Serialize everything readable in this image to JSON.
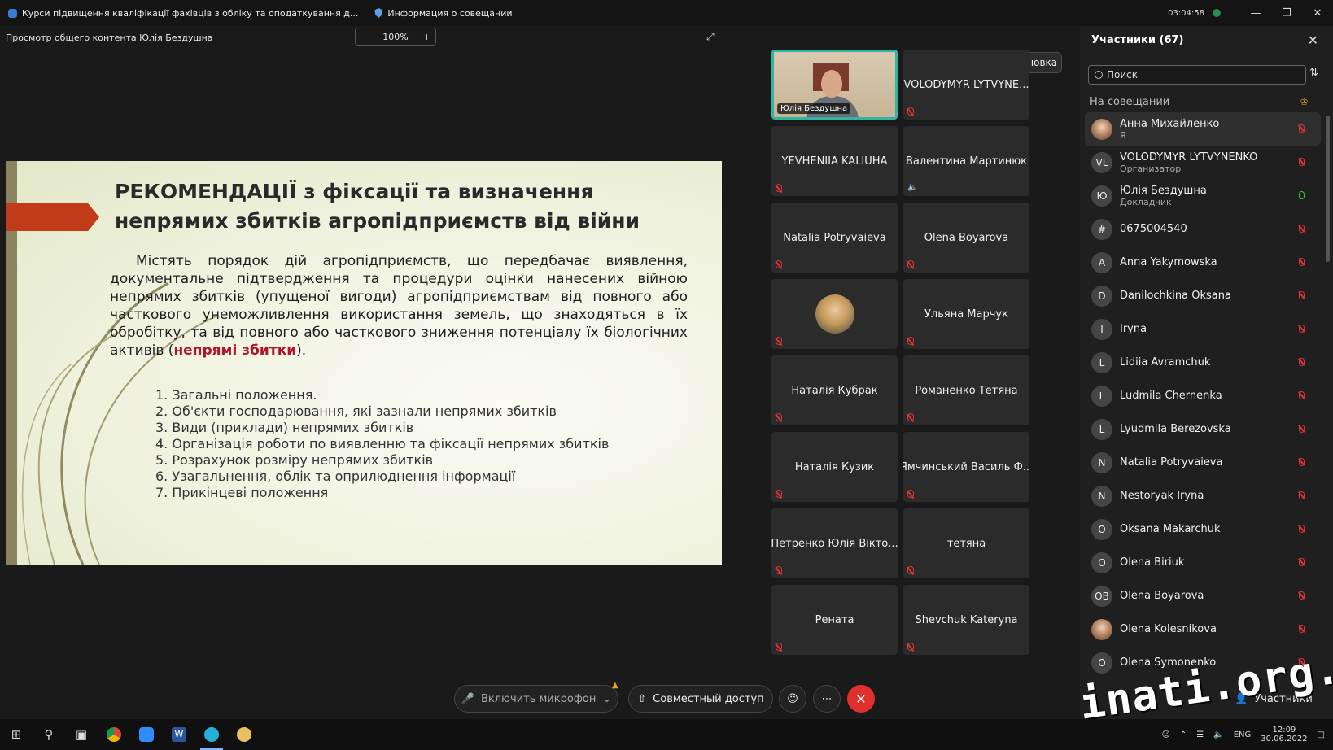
{
  "titlebar": {
    "tab1": "Курси підвищення кваліфікації фахівців з обліку та оподаткування д...",
    "tab2": "Информация о совещании",
    "time": "03:04:58"
  },
  "infobar": {
    "label": "Просмотр общего контента Юлія Бездушна",
    "zoom": "100%"
  },
  "slide": {
    "title": "РЕКОМЕНДАЦІЇ з фіксації та визначення непрямих збитків агропідприємств від війни",
    "para_main": "Містять порядок дій агропідприємств, що передбачає виявлення, документальне підтвердження та процедури оцінки нанесених війною непрямих збитків (упущеної вигоди) агропідприємствам від повного або часткового унеможливлення використання земель, що знаходяться в їх обробітку, та від повного або часткового зниження потенціалу їх біологічних активів (",
    "para_red": "непрямі збитки",
    "para_end": ").",
    "items": [
      "1. Загальні положення.",
      "2. Об'єкти господарювання, які зазнали непрямих збитків",
      "3. Види (приклади) непрямих збитків",
      "4. Організація роботи по виявленню та фіксації непрямих збитків",
      "5. Розрахунок розміру непрямих збитків",
      "6. Узагальнення, облік та оприлюднення інформації",
      "7. Прикінцеві положення"
    ]
  },
  "tiles": {
    "layout_label": "Компоновка",
    "speaker_chip": "Юлія Бездушна",
    "names": [
      "VOLODYMYR LYTVYNE...",
      "YEVHENIIA KALIUHA",
      "Валентина Мартинюк",
      "Natalia Potryvaieva",
      "Olena Boyarova",
      "Ульяна Марчук",
      "Наталія Кубрак",
      "Романенко Тетяна",
      "Наталія Кузик",
      "Ямчинський Василь Ф...",
      "Петренко Юлія Вікто...",
      "тетяна",
      "Рената",
      "Shevchuk Kateryna"
    ]
  },
  "panel": {
    "title": "Участники (67)",
    "search_placeholder": "Поиск",
    "section": "На совещании",
    "participants": [
      {
        "initials": "",
        "name": "Анна Михайленко",
        "role": "Я"
      },
      {
        "initials": "VL",
        "name": "VOLODYMYR LYTVYNENKO",
        "role": "Организатор"
      },
      {
        "initials": "Ю",
        "name": "Юлія Бездушна",
        "role": "Докладчик"
      },
      {
        "initials": "#",
        "name": "0675004540",
        "role": ""
      },
      {
        "initials": "A",
        "name": "Anna Yakymowska",
        "role": ""
      },
      {
        "initials": "D",
        "name": "Danilochkina Oksana",
        "role": ""
      },
      {
        "initials": "I",
        "name": "Iryna",
        "role": ""
      },
      {
        "initials": "L",
        "name": "Lidiia Avramchuk",
        "role": ""
      },
      {
        "initials": "L",
        "name": "Ludmila Chernenka",
        "role": ""
      },
      {
        "initials": "L",
        "name": "Lyudmila Berezovska",
        "role": ""
      },
      {
        "initials": "N",
        "name": "Natalia Potryvaieva",
        "role": ""
      },
      {
        "initials": "N",
        "name": "Nestoryak Iryna",
        "role": ""
      },
      {
        "initials": "O",
        "name": "Oksana Makarchuk",
        "role": ""
      },
      {
        "initials": "O",
        "name": "Olena Biriuk",
        "role": ""
      },
      {
        "initials": "OB",
        "name": "Olena Boyarova",
        "role": ""
      },
      {
        "initials": "",
        "name": "Olena Kolesnikova",
        "role": ""
      },
      {
        "initials": "O",
        "name": "Olena Symonenko",
        "role": ""
      }
    ]
  },
  "controls": {
    "mic_label": "Включить микрофон",
    "share_label": "Совместный доступ",
    "participants_label": "Участники"
  },
  "taskbar": {
    "lang": "ENG",
    "time": "12:09",
    "date": "30.06.2022"
  },
  "watermark": "inati.org.ua"
}
